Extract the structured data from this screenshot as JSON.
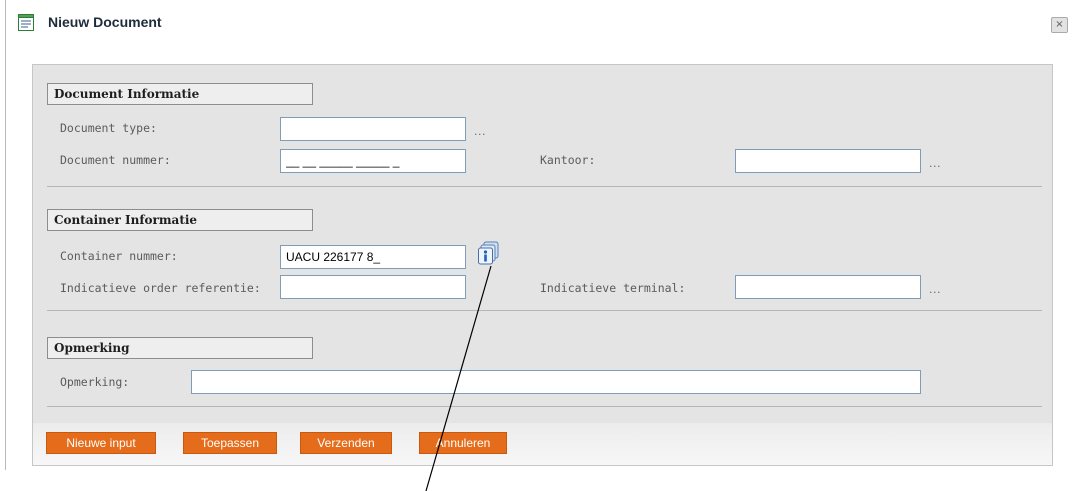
{
  "window": {
    "title": "Nieuw Document",
    "close_glyph": "×"
  },
  "sections": {
    "document": {
      "title": "Document Informatie",
      "type_label": "Document type:",
      "type_value": "",
      "number_label": "Document nummer:",
      "number_value": "__ __ _____ _____ _",
      "office_label": "Kantoor:",
      "office_value": "",
      "ellipsis": "..."
    },
    "container": {
      "title": "Container Informatie",
      "number_label": "Container nummer:",
      "number_value": "UACU 226177 8_",
      "order_label": "Indicatieve order referentie:",
      "order_value": "",
      "terminal_label": "Indicatieve terminal:",
      "terminal_value": "",
      "ellipsis": "...",
      "info_icon": "info-icon"
    },
    "remark": {
      "title": "Opmerking",
      "label": "Opmerking:",
      "value": ""
    }
  },
  "buttons": {
    "new_input": "Nieuwe input",
    "apply": "Toepassen",
    "send": "Verzenden",
    "cancel": "Annuleren"
  },
  "colors": {
    "button_bg": "#e56c1a",
    "panel_bg": "#e4e4e4",
    "field_border": "#7f9db9"
  }
}
